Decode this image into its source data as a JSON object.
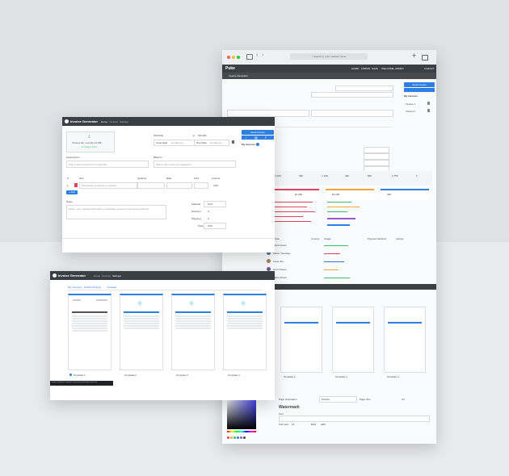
{
  "browser": {
    "address": "Search or enter website name"
  },
  "app": {
    "title": "Invoice Generator",
    "nav": [
      "Home",
      "Invoices",
      "Settings"
    ],
    "logo": "Puke",
    "top_links": [
      "HOME",
      "FORMS",
      "SAVE",
      "WELCOME, ADMIN!",
      "LOGOUT"
    ]
  },
  "invoice_form": {
    "upload_hint": "Choose file, max file 10 MB",
    "upload_link": "or Drag it here",
    "invoice_label": "INVOICE",
    "invoice_no": "INV-001",
    "date_issued": "Issue Date",
    "date_due": "Due Date",
    "date_placeholder": "mm/dd/yyyy",
    "issued_from": "Issued From",
    "issued_from_placeholder": "Who is this invoice from? (required)",
    "bill_to": "Billed to",
    "bill_to_placeholder": "Who is this invoice to? (required)",
    "columns": [
      "#",
      "Item",
      "Quantity",
      "Rate",
      "GST",
      "Amount"
    ],
    "row_index": "1",
    "item_placeholder": "Description of service or product",
    "amount": "0.00",
    "add_line": "+ Add Line",
    "notes_label": "Notes",
    "notes_placeholder": "Notes - any relevant information not already covered, terms and conditions",
    "totals": [
      {
        "label": "Subtotal",
        "value": "0.00"
      },
      {
        "label": "Discount",
        "value": "0"
      },
      {
        "label": "Shipping",
        "value": "0"
      },
      {
        "label": "Total",
        "value": "0.00"
      }
    ],
    "send_invoice": "Send Invoice",
    "my_invoices": "My Invoices",
    "invoice_items": [
      "Invoice 1",
      "Invoice 2"
    ]
  },
  "settings": {
    "tabs": [
      "My Company",
      "Default Settings",
      "Template"
    ],
    "templates": [
      "Template 1",
      "Template 2",
      "Template 3",
      "Template 4"
    ],
    "footer_text": "Invoice Generator Template, https://www.invoice-generator.com",
    "page_orientation_label": "Page Orientation",
    "page_orientation_value": "Portrait",
    "page_size_label": "Page Size",
    "page_size_value": "A4",
    "watermark_label": "Watermark",
    "watermark_sub": "Text",
    "font_size_label": "Font size",
    "font_size_value": "12",
    "bold": "Bold",
    "italic": "Italic"
  },
  "dashboard": {
    "stat_values": [
      "1,200",
      "530",
      "1,100",
      "400",
      "850",
      "1,750",
      "1"
    ],
    "cards": [
      {
        "label": "Revenue",
        "value": "$1,000",
        "color": "#e0455f"
      },
      {
        "label": "Orders",
        "value": "$2,300",
        "color": "#f0a63a"
      },
      {
        "label": "Customers",
        "value": "400",
        "color": "#2f7fe3"
      }
    ],
    "users": [
      "Maria Green",
      "Martin Tremblay",
      "Louis Jan",
      "Kevin Moore",
      "Marco Rossi"
    ],
    "user_col_headers": [
      "User",
      "Country",
      "Usage",
      "Payment Method",
      "Activity"
    ]
  },
  "colors": {
    "accent": "#2f7fe3",
    "header_dark": "#3a3f44",
    "danger": "#e0455f",
    "success": "#3fbf6a",
    "warning": "#f0a63a"
  }
}
